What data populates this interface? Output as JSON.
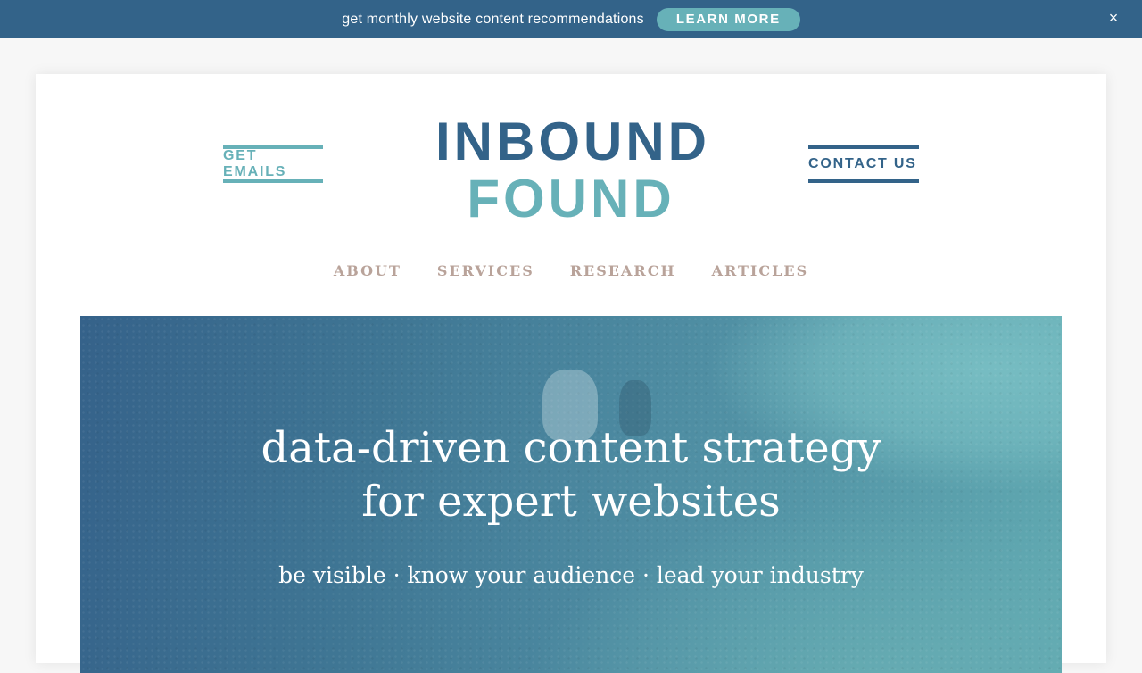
{
  "banner": {
    "text": "get monthly website content recommendations",
    "button_label": "LEARN MORE",
    "close_label": "×"
  },
  "header": {
    "left_link": "GET EMAILS",
    "right_link": "CONTACT US",
    "logo_line1": "INBOUND",
    "logo_line2": "FOUND"
  },
  "nav": {
    "items": [
      {
        "label": "ABOUT"
      },
      {
        "label": "SERVICES"
      },
      {
        "label": "RESEARCH"
      },
      {
        "label": "ARTICLES"
      }
    ]
  },
  "hero": {
    "title_line1": "data-driven content strategy",
    "title_line2": "for expert websites",
    "subtitle": "be visible · know your audience · lead your industry"
  },
  "colors": {
    "primary_blue": "#336389",
    "accent_teal": "#67b1b8",
    "nav_taupe": "#b9a39a"
  }
}
